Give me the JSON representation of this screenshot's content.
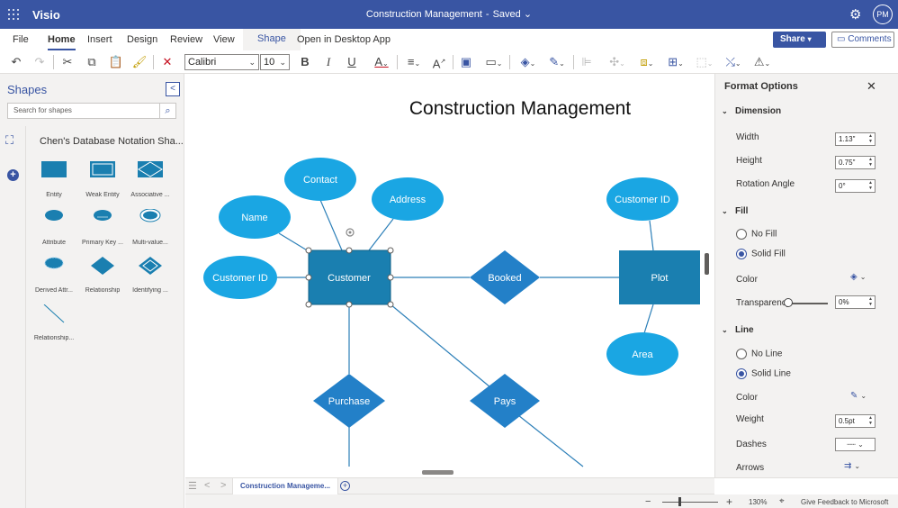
{
  "app": {
    "name": "Visio"
  },
  "document": {
    "title": "Construction Management",
    "status": "Saved"
  },
  "user": {
    "initials": "PM"
  },
  "menu": {
    "tabs": [
      "File",
      "Home",
      "Insert",
      "Design",
      "Review",
      "View",
      "Shape"
    ],
    "active_tab": "Home",
    "open_desktop": "Open in Desktop App",
    "share": "Share",
    "comments": "Comments"
  },
  "toolbar": {
    "font_name": "Calibri",
    "font_size": "10"
  },
  "shapes_pane": {
    "title": "Shapes",
    "search_placeholder": "Search for shapes",
    "stencil_name": "Chen's Database Notation Sha...",
    "items": [
      {
        "label": "Entity",
        "icon": "entity-shape-icon"
      },
      {
        "label": "Weak Entity",
        "icon": "weak-entity-shape-icon"
      },
      {
        "label": "Associative ...",
        "icon": "associative-entity-shape-icon"
      },
      {
        "label": "Attribute",
        "icon": "attribute-shape-icon"
      },
      {
        "label": "Primary Key ...",
        "icon": "primary-key-shape-icon"
      },
      {
        "label": "Multi-value...",
        "icon": "multivalued-attribute-shape-icon"
      },
      {
        "label": "Derived Attr...",
        "icon": "derived-attribute-shape-icon"
      },
      {
        "label": "Relationship",
        "icon": "relationship-shape-icon"
      },
      {
        "label": "Identifying ...",
        "icon": "identifying-relationship-shape-icon"
      },
      {
        "label": "Relationship...",
        "icon": "relationship-connector-shape-icon"
      }
    ]
  },
  "diagram": {
    "title": "Construction Management",
    "entities": {
      "customer": "Customer",
      "plot": "Plot"
    },
    "attributes": {
      "contact": "Contact",
      "name": "Name",
      "address": "Address",
      "customer_id_left": "Customer ID",
      "customer_id_right": "Customer ID",
      "area": "Area"
    },
    "relationships": {
      "booked": "Booked",
      "purchase": "Purchase",
      "pays": "Pays"
    },
    "colors": {
      "entity": "#1a7fb0",
      "attribute": "#1aa6e3",
      "relationship": "#2380c8",
      "line": "#2c7fb8"
    }
  },
  "bottom": {
    "page_tab": "Construction Manageme...",
    "zoom": "130%",
    "feedback": "Give Feedback to Microsoft"
  },
  "format_pane": {
    "title": "Format Options",
    "dimension": {
      "header": "Dimension",
      "width_label": "Width",
      "width_value": "1.13\"",
      "height_label": "Height",
      "height_value": "0.75\"",
      "rotation_label": "Rotation Angle",
      "rotation_value": "0°"
    },
    "fill": {
      "header": "Fill",
      "no_fill": "No Fill",
      "solid_fill": "Solid Fill",
      "selected": "Solid Fill",
      "color_label": "Color",
      "transparency_label": "Transparency",
      "transparency_value": "0%",
      "transparency_level": 0
    },
    "line": {
      "header": "Line",
      "no_line": "No Line",
      "solid_line": "Solid Line",
      "selected": "Solid Line",
      "color_label": "Color",
      "weight_label": "Weight",
      "weight_value": "0.5pt",
      "dashes_label": "Dashes",
      "arrows_label": "Arrows"
    }
  }
}
